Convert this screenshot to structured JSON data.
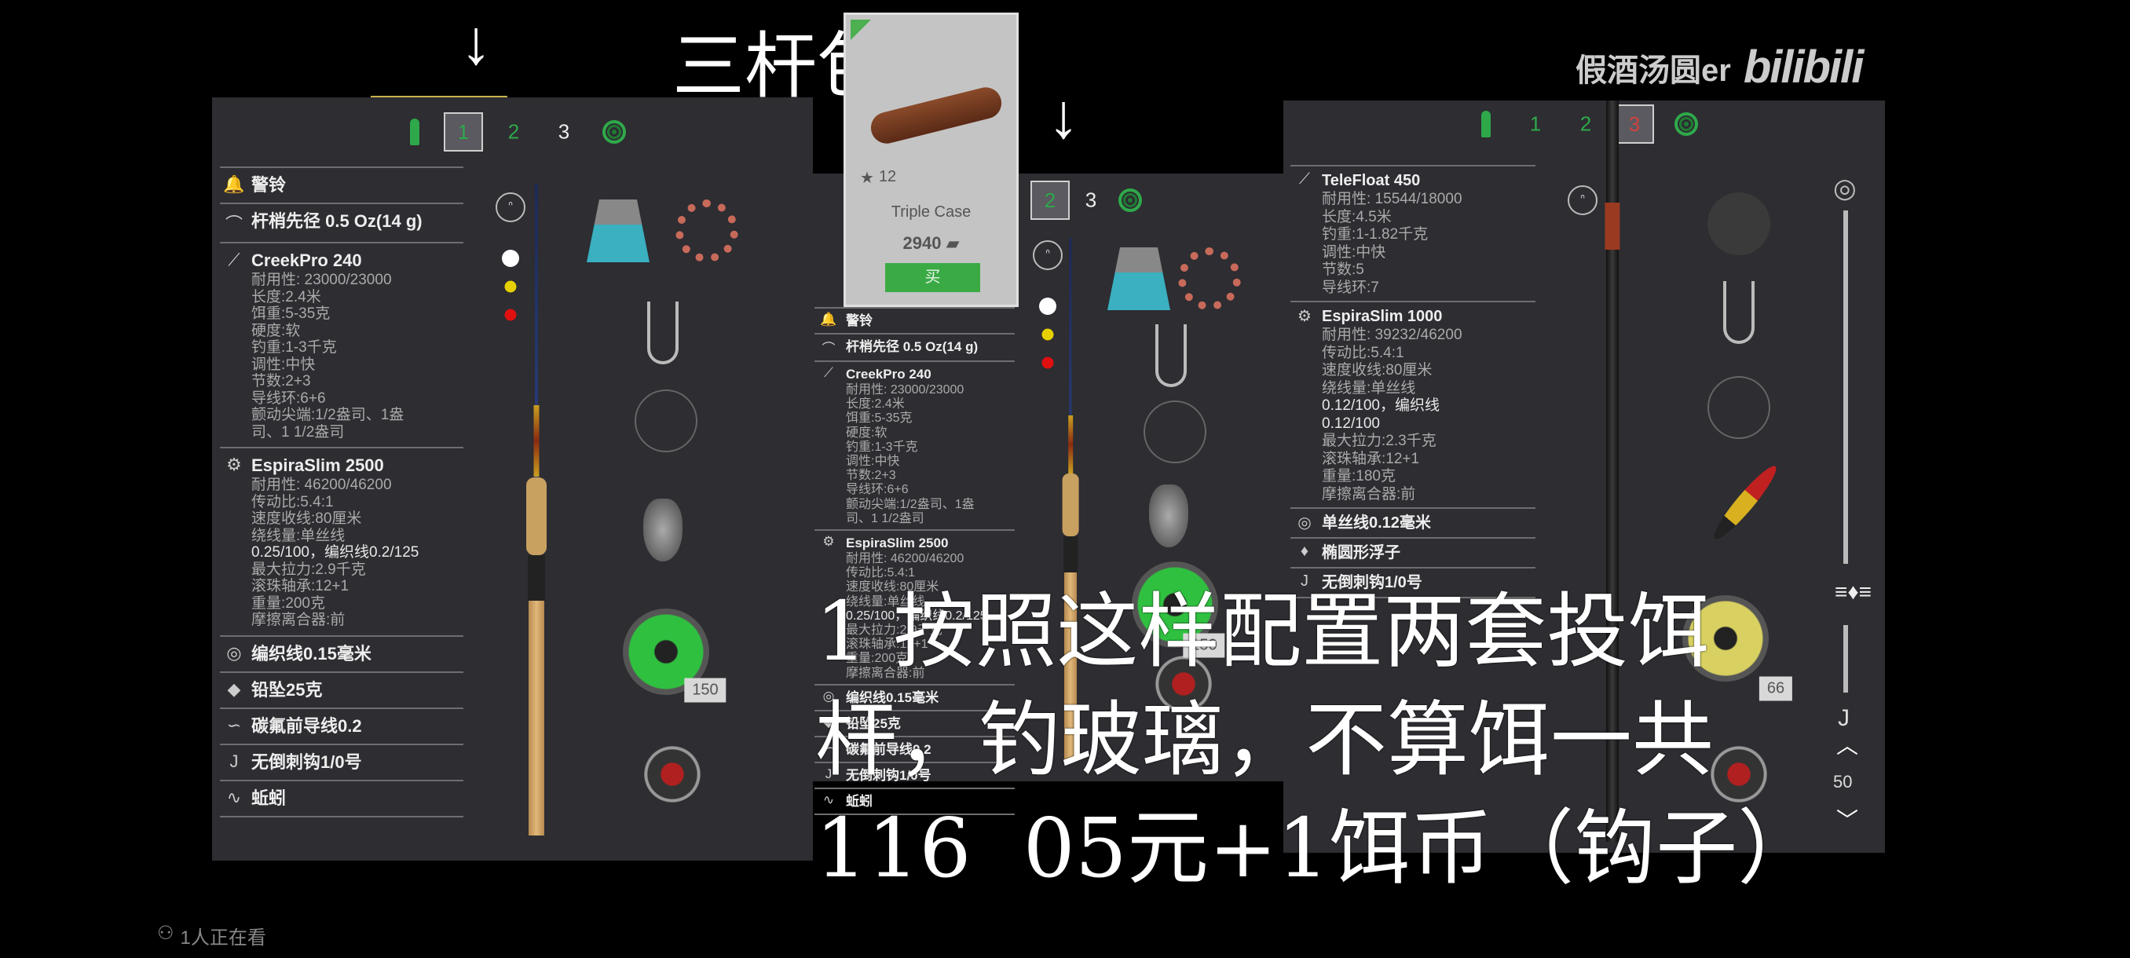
{
  "title": "三杆包",
  "watermark": {
    "author": "假酒汤圆er",
    "logo": "bilibili"
  },
  "viewers": "1人正在看",
  "colors": {
    "panel": "#2d2d32",
    "green": "#2fa84a",
    "red": "#d03a3a",
    "buy": "#3aaa45"
  },
  "popup": {
    "stars": "12",
    "name": "Triple Case",
    "price": "2940",
    "buy_label": "买",
    "icon": "money-stack-icon"
  },
  "subtitle": [
    "1 按照这样配置两套投饵",
    "杆，钓玻璃，不算饵一共",
    "116  05元+1饵币（钩子）"
  ],
  "panels": [
    {
      "tabs": [
        "1",
        "2",
        "3"
      ],
      "active_tab": "1",
      "items": [
        {
          "icon": "bell-icon",
          "title": "警铃",
          "details": []
        },
        {
          "icon": "rod-tip-icon",
          "title": "杆梢先径 0.5 Oz(14 g)",
          "details": []
        },
        {
          "icon": "rod-icon",
          "title": "CreekPro 240",
          "details": [
            "耐用性: 23000/23000",
            "长度:2.4米",
            "饵重:5-35克",
            "硬度:软",
            "钓重:1-3千克",
            "调性:中快",
            "节数:2+3",
            "导线环:6+6",
            "颤动尖端:1/2盎司、1盎",
            "司、1 1/2盎司"
          ]
        },
        {
          "icon": "reel-icon",
          "title": "EspiraSlim 2500",
          "details": [
            "耐用性: 46200/46200",
            "传动比:5.4:1",
            "速度收线:80厘米",
            "绕线量:单丝线",
            "0.25/100，编织线0.2/125",
            "最大拉力:2.9千克",
            "滚珠轴承:12+1",
            "重量:200克",
            "摩擦离合器:前"
          ]
        },
        {
          "icon": "line-spool-icon",
          "title": "编织线0.15毫米",
          "details": []
        },
        {
          "icon": "sinker-icon",
          "title": "铅坠25克",
          "details": []
        },
        {
          "icon": "leader-icon",
          "title": "碳氟前导线0.2",
          "details": []
        },
        {
          "icon": "hook-icon",
          "title": "无倒刺钩1/0号",
          "details": []
        },
        {
          "icon": "worm-icon",
          "title": "蚯蚓",
          "details": []
        }
      ],
      "line_count": "150"
    },
    {
      "tabs": [
        "2",
        "3"
      ],
      "active_tab": "2",
      "items": [
        {
          "icon": "bell-icon",
          "title": "警铃",
          "details": []
        },
        {
          "icon": "rod-tip-icon",
          "title": "杆梢先径 0.5 Oz(14 g)",
          "details": []
        },
        {
          "icon": "rod-icon",
          "title": "CreekPro 240",
          "details": [
            "耐用性: 23000/23000",
            "长度:2.4米",
            "饵重:5-35克",
            "硬度:软",
            "钓重:1-3千克",
            "调性:中快",
            "节数:2+3",
            "导线环:6+6",
            "颤动尖端:1/2盎司、1盎",
            "司、1 1/2盎司"
          ]
        },
        {
          "icon": "reel-icon",
          "title": "EspiraSlim 2500",
          "details": [
            "耐用性: 46200/46200",
            "传动比:5.4:1",
            "速度收线:80厘米",
            "绕线量:单丝线",
            "0.25/100，编织线0.2/125",
            "最大拉力:2.9千克",
            "滚珠轴承:12+1",
            "重量:200克",
            "摩擦离合器:前"
          ]
        },
        {
          "icon": "line-spool-icon",
          "title": "编织线0.15毫米",
          "details": []
        },
        {
          "icon": "sinker-icon",
          "title": "铅坠25克",
          "details": []
        },
        {
          "icon": "leader-icon",
          "title": "碳氟前导线0.2",
          "details": []
        },
        {
          "icon": "hook-icon",
          "title": "无倒刺钩1/0号",
          "details": []
        },
        {
          "icon": "worm-icon",
          "title": "蚯蚓",
          "details": []
        }
      ],
      "line_count": "150"
    },
    {
      "tabs": [
        "1",
        "2",
        "3"
      ],
      "active_tab": "3",
      "items": [
        {
          "icon": "rod-icon",
          "title": "TeleFloat 450",
          "details": [
            "耐用性: 15544/18000",
            "长度:4.5米",
            "钓重:1-1.82千克",
            "调性:中快",
            "节数:5",
            "导线环:7"
          ]
        },
        {
          "icon": "reel-icon",
          "title": "EspiraSlim 1000",
          "details": [
            "耐用性: 39232/46200",
            "传动比:5.4:1",
            "速度收线:80厘米",
            "绕线量:单丝线",
            "0.12/100，编织线",
            "0.12/100",
            "最大拉力:2.3千克",
            "滚珠轴承:12+1",
            "重量:180克",
            "摩擦离合器:前"
          ]
        },
        {
          "icon": "line-spool-icon",
          "title": "单丝线0.12毫米",
          "details": []
        },
        {
          "icon": "float-icon",
          "title": "椭圆形浮子",
          "details": []
        },
        {
          "icon": "hook-icon",
          "title": "无倒刺钩1/0号",
          "details": []
        }
      ],
      "line_count": "66",
      "depth_value": "50"
    }
  ]
}
